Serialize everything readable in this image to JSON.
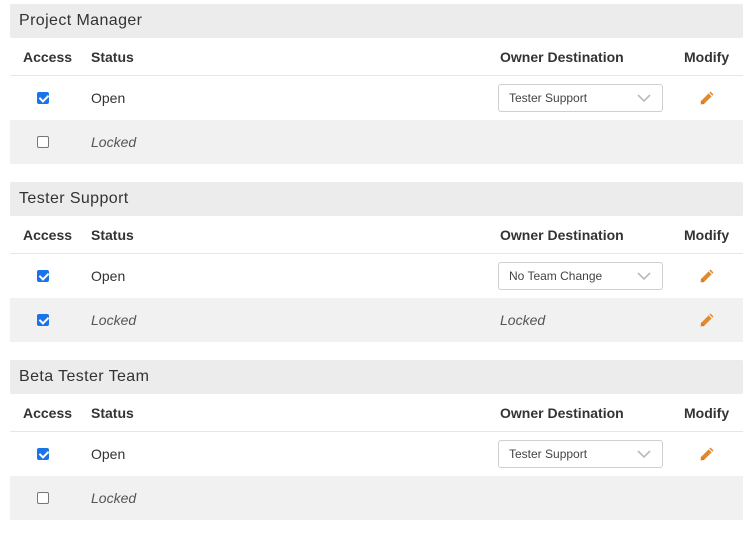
{
  "columns": {
    "access": "Access",
    "status": "Status",
    "owner": "Owner Destination",
    "modify": "Modify"
  },
  "sections": [
    {
      "title": "Project Manager",
      "rows": [
        {
          "checked": true,
          "status": "Open",
          "owner_type": "select",
          "owner": "Tester Support",
          "modify": true
        },
        {
          "checked": false,
          "status": "Locked",
          "owner_type": "none",
          "owner": "",
          "modify": false
        }
      ]
    },
    {
      "title": "Tester Support",
      "rows": [
        {
          "checked": true,
          "status": "Open",
          "owner_type": "select",
          "owner": "No Team Change",
          "modify": true
        },
        {
          "checked": true,
          "status": "Locked",
          "owner_type": "text",
          "owner": "Locked",
          "modify": true
        }
      ]
    },
    {
      "title": "Beta Tester Team",
      "rows": [
        {
          "checked": true,
          "status": "Open",
          "owner_type": "select",
          "owner": "Tester Support",
          "modify": true
        },
        {
          "checked": false,
          "status": "Locked",
          "owner_type": "none",
          "owner": "",
          "modify": false
        }
      ]
    }
  ],
  "icons": {
    "modify": "pencil-icon",
    "dropdown": "chevron-down-icon"
  },
  "colors": {
    "accent_checkbox": "#1a73e8",
    "pencil": "#e08a2e",
    "header_bg": "#ececec",
    "alt_row_bg": "#f1f1f1"
  }
}
